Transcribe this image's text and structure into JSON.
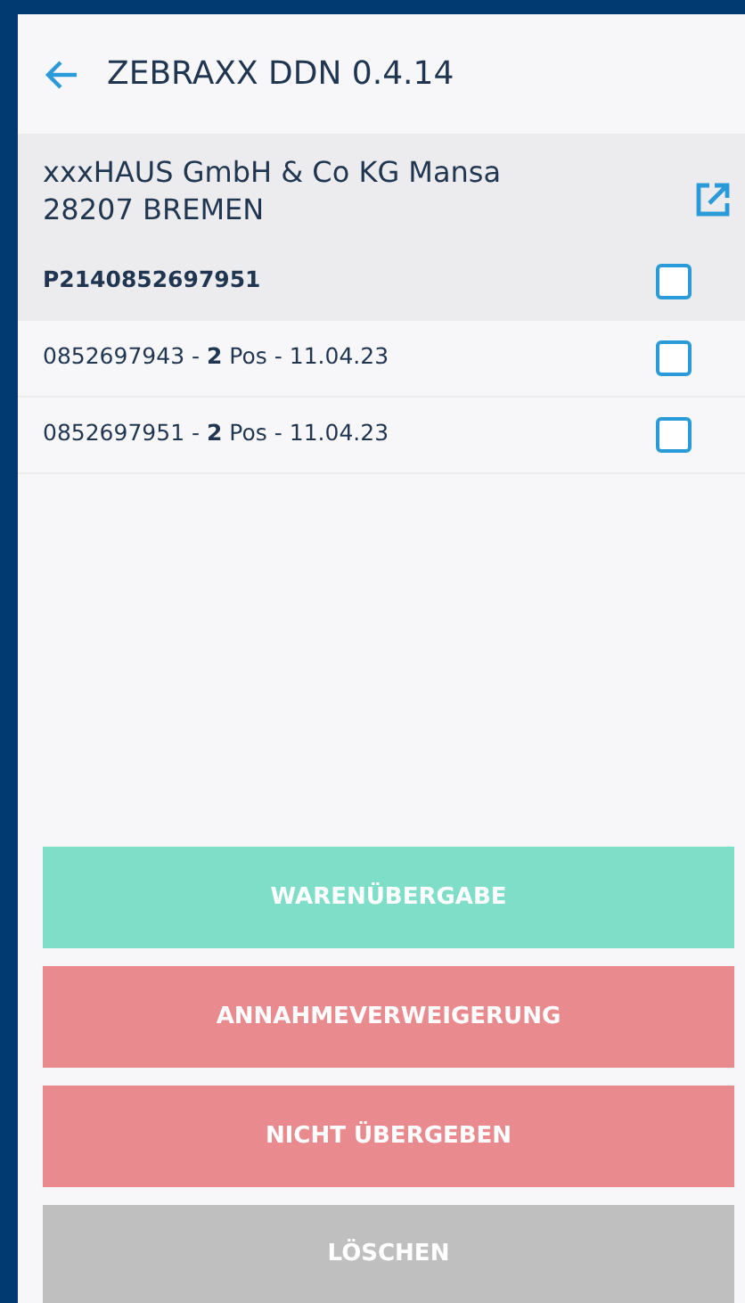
{
  "header": {
    "title": "ZEBRAXX DDN 0.4.14"
  },
  "address": {
    "lines": [
      "xxxHAUS GmbH & Co KG Mansa",
      "28207 BREMEN"
    ]
  },
  "items": [
    {
      "label": "P2140852697951",
      "kind": "group",
      "checked": false
    },
    {
      "label": "0852697943 - **2** Pos - 11.04.23",
      "kind": "entry",
      "checked": false
    },
    {
      "label": "0852697951 - **2** Pos - 11.04.23",
      "kind": "entry",
      "checked": false
    }
  ],
  "buttons": [
    {
      "label": "WARENÜBERGABE",
      "kind": "success"
    },
    {
      "label": "ANNAHMEVERWEIGERUNG",
      "kind": "danger"
    },
    {
      "label": "NICHT ÜBERGEBEN",
      "kind": "danger"
    },
    {
      "label": "LÖSCHEN",
      "kind": "neutral"
    }
  ]
}
